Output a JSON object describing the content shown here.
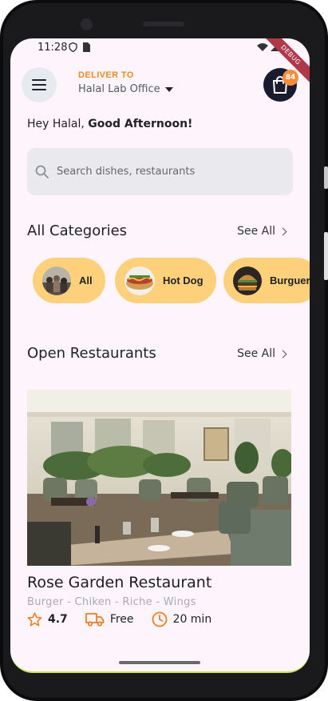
{
  "status_bar": {
    "time": "11:28",
    "ribbon": "DEBUG"
  },
  "header": {
    "deliver_label": "DELIVER TO",
    "location": "Halal Lab Office",
    "cart_count": "84"
  },
  "greeting": {
    "prefix": "Hey Halal, ",
    "emphasis": "Good Afternoon!"
  },
  "search": {
    "placeholder": "Search dishes, restaurants"
  },
  "categories_section": {
    "title": "All Categories",
    "see_all": "See All",
    "items": [
      {
        "label": "All"
      },
      {
        "label": "Hot Dog"
      },
      {
        "label": "Burguer"
      }
    ]
  },
  "restaurants_section": {
    "title": "Open Restaurants",
    "see_all": "See All",
    "items": [
      {
        "name": "Rose Garden Restaurant",
        "tags": "Burger - Chiken - Riche - Wings",
        "rating": "4.7",
        "delivery": "Free",
        "time": "20 min"
      }
    ]
  },
  "colors": {
    "accent": "#f08a24",
    "category_bg": "#fdd17b",
    "cart_bg": "#181c2e",
    "screen_bg": "#fdf5fb"
  }
}
